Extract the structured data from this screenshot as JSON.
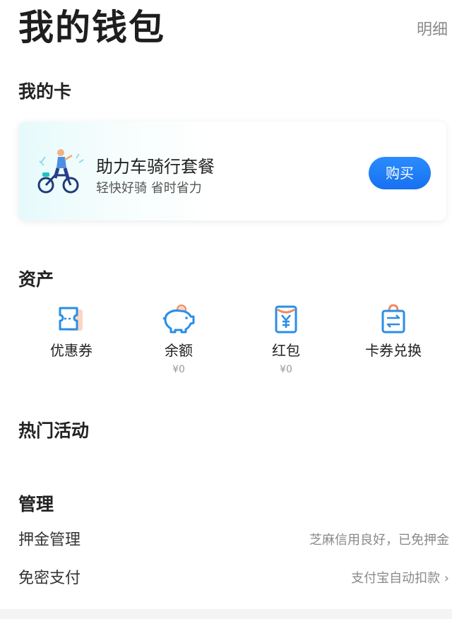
{
  "header": {
    "title": "我的钱包",
    "detail_link": "明细"
  },
  "my_cards": {
    "section_title": "我的卡",
    "card": {
      "title": "助力车骑行套餐",
      "subtitle": "轻快好骑 省时省力",
      "buy_label": "购买"
    }
  },
  "assets": {
    "section_title": "资产",
    "items": [
      {
        "label": "优惠券",
        "value": "",
        "icon": "ticket-icon"
      },
      {
        "label": "余额",
        "value": "¥0",
        "icon": "piggy-bank-icon"
      },
      {
        "label": "红包",
        "value": "¥0",
        "icon": "red-envelope-icon"
      },
      {
        "label": "卡券兑换",
        "value": "",
        "icon": "exchange-bag-icon"
      }
    ]
  },
  "hot_activities": {
    "section_title": "热门活动"
  },
  "management": {
    "section_title": "管理",
    "rows": [
      {
        "label": "押金管理",
        "value": "芝麻信用良好，已免押金"
      },
      {
        "label": "免密支付",
        "value": "支付宝自动扣款 ›"
      }
    ]
  },
  "colors": {
    "accent": "#1677ff",
    "icon_blue": "#2a8ee6",
    "icon_orange": "#f08a5d"
  }
}
